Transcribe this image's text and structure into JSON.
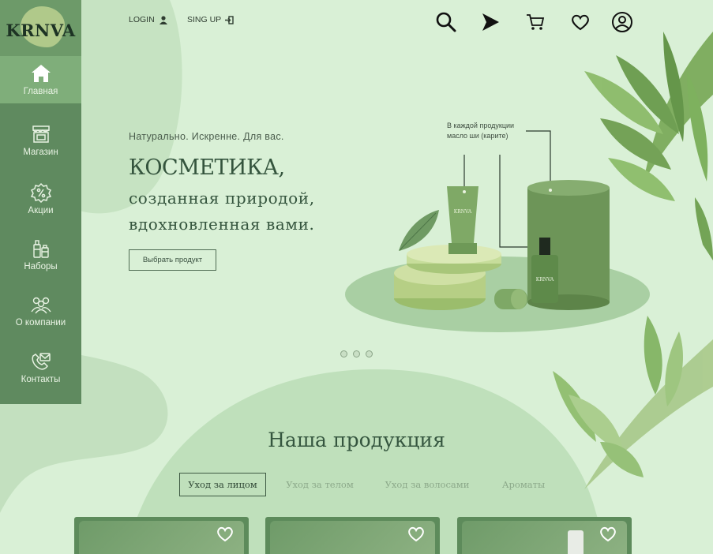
{
  "brand": {
    "logo": "KRNVA"
  },
  "auth": {
    "login_label": "LOGIN",
    "signup_label": "SING UP"
  },
  "top_icons": [
    "search-icon",
    "send-icon",
    "cart-icon",
    "heart-icon",
    "user-icon"
  ],
  "sidebar": {
    "items": [
      {
        "label": "Главная",
        "icon": "home-icon",
        "active": true
      },
      {
        "label": "Магазин",
        "icon": "store-icon"
      },
      {
        "label": "Акции",
        "icon": "discount-icon"
      },
      {
        "label": "Наборы",
        "icon": "products-icon"
      },
      {
        "label": "О компании",
        "icon": "people-icon"
      },
      {
        "label": "Контакты",
        "icon": "contact-icon"
      }
    ]
  },
  "hero": {
    "tagline": "Натурально.  Искренне. Для вас.",
    "title": "КОСМЕТИКА,",
    "line2": "созданная природой,",
    "line3": "вдохновленная вами.",
    "button": "Выбрать продукт",
    "callout": "В каждой продукции масло ши (карите)",
    "product_label": "KRNVA"
  },
  "carousel": {
    "dots": 3
  },
  "products": {
    "title": "Наша продукция",
    "tabs": [
      "Уход за лицом",
      "Уход за телом",
      "Уход за волосами",
      "Ароматы"
    ],
    "active_tab": 0,
    "cards": 3
  },
  "colors": {
    "background": "#d9f0d6",
    "sidebar": "#5f8a5f",
    "sidebar_active": "#7fae7a",
    "accent": "#35563f"
  }
}
